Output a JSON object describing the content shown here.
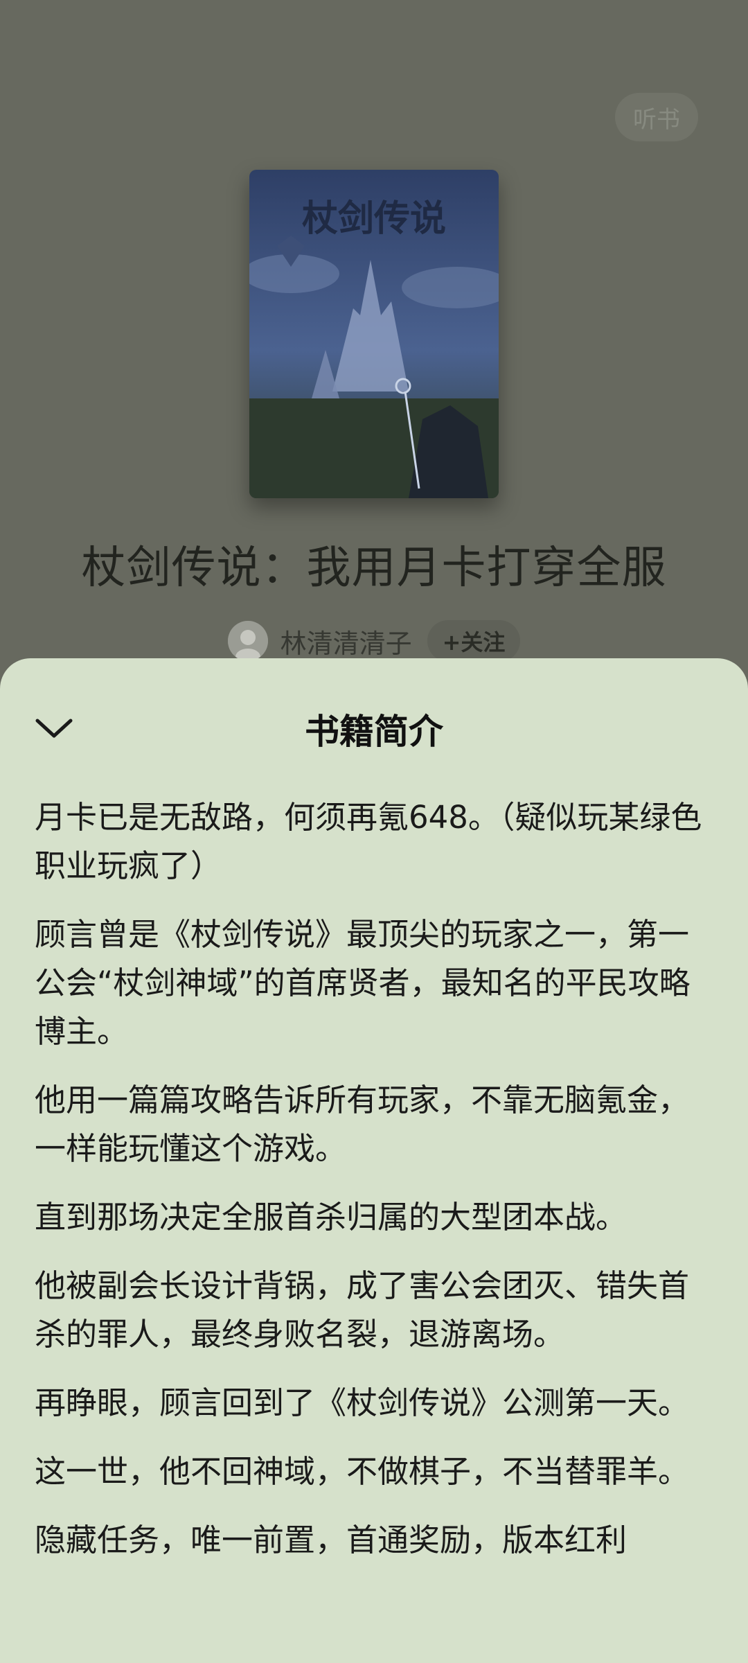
{
  "header": {
    "listen_label": "听书"
  },
  "book": {
    "cover_title": "杖剑传说",
    "title": "杖剑传说：我用月卡打穿全服",
    "author": "林清清清子",
    "follow_label": "+关注"
  },
  "sheet": {
    "title": "书籍简介",
    "paragraphs": [
      "月卡已是无敌路，何须再氪648。（疑似玩某绿色职业玩疯了）",
      "顾言曾是《杖剑传说》最顶尖的玩家之一，第一公会“杖剑神域”的首席贤者，最知名的平民攻略博主。",
      "他用一篇篇攻略告诉所有玩家，不靠无脑氪金，一样能玩懂这个游戏。",
      "直到那场决定全服首杀归属的大型团本战。",
      "他被副会长设计背锅，成了害公会团灭、错失首杀的罪人，最终身败名裂，退游离场。",
      "再睁眼，顾言回到了《杖剑传说》公测第一天。",
      "这一世，他不回神域，不做棋子，不当替罪羊。",
      "隐藏任务，唯一前置，首通奖励，版本红利"
    ]
  }
}
